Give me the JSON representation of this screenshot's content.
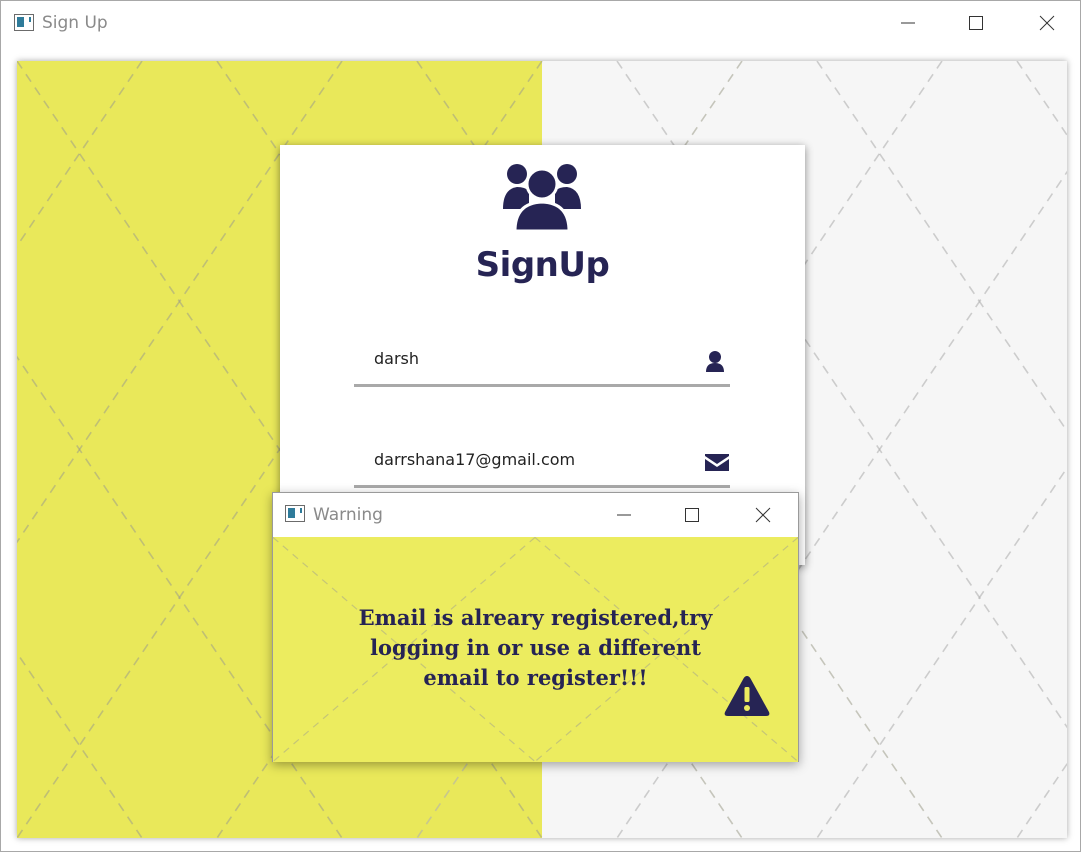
{
  "window": {
    "title": "Sign Up",
    "minimize_label": "minimize",
    "maximize_label": "maximize",
    "close_label": "close"
  },
  "colors": {
    "yellow_panel": "#e9e85a",
    "white_panel": "#f6f6f6",
    "brand_navy": "#262454",
    "underline": "#a9a9a9",
    "dialog_body": "#ecec5f"
  },
  "card": {
    "icon": "users-group-icon",
    "title": "SignUp",
    "username": {
      "value": "darsh",
      "icon": "user-icon"
    },
    "email": {
      "value": "darrshana17@gmail.com",
      "icon": "envelope-icon"
    }
  },
  "dialog": {
    "title": "Warning",
    "message": "Email is alreary registered,try logging in or use a different email to register!!!",
    "icon": "warning-triangle-icon"
  }
}
